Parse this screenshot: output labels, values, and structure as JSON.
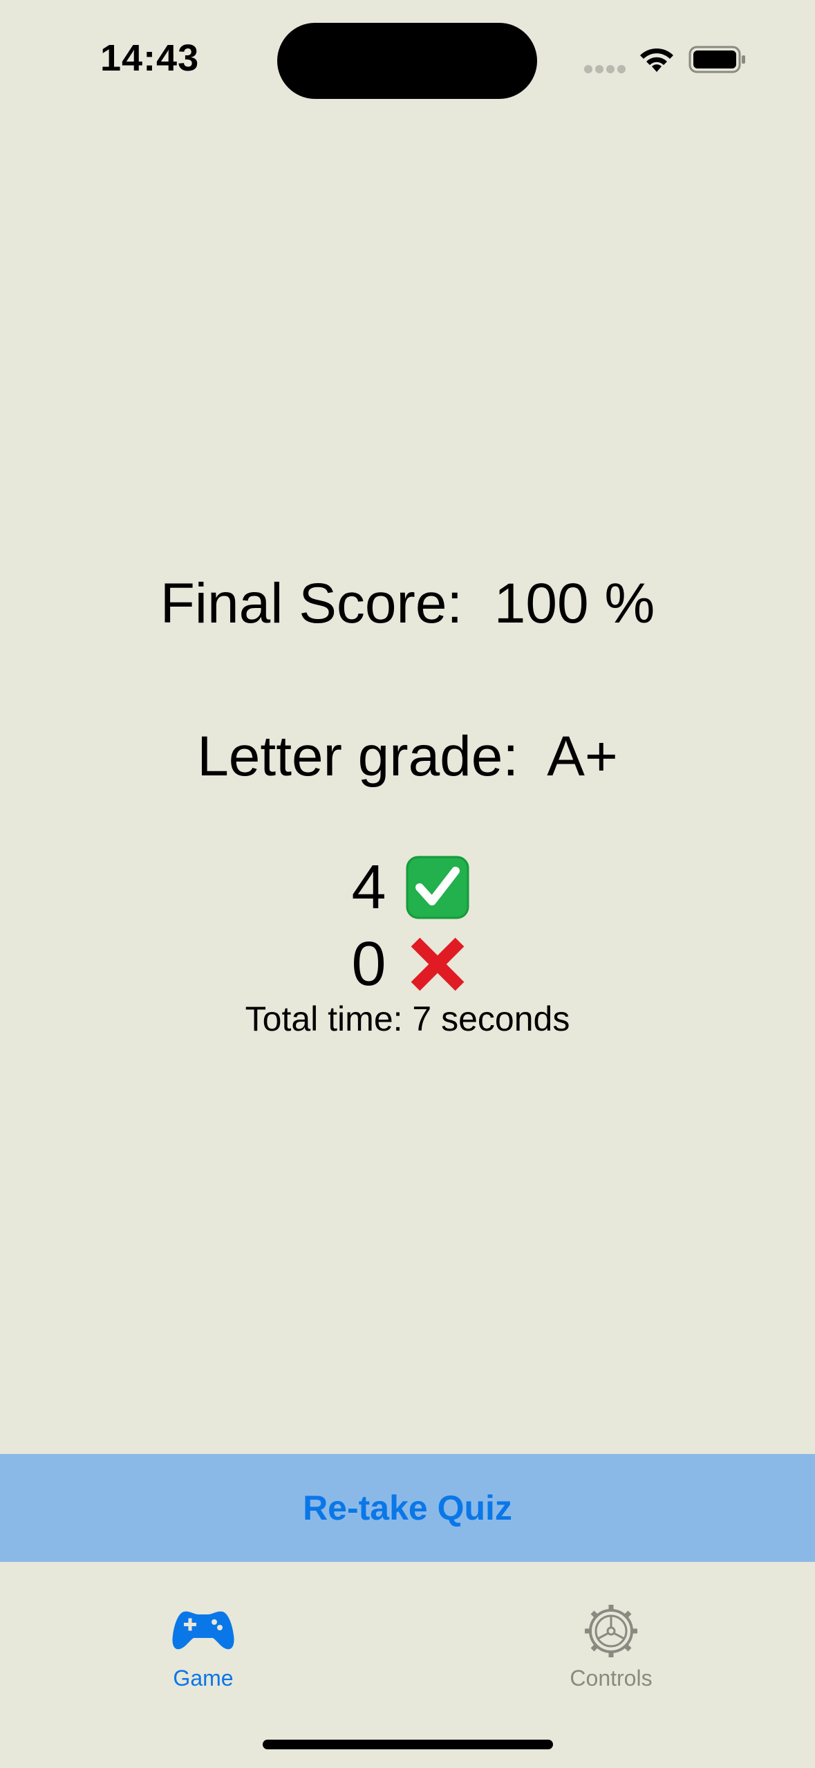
{
  "status_bar": {
    "time": "14:43"
  },
  "results": {
    "final_score_text": "Final Score:  100 %",
    "letter_grade_text": "Letter grade:  A+",
    "correct_count": "4",
    "wrong_count": "0",
    "total_time_text": "Total time: 7 seconds"
  },
  "icons": {
    "correct": "check-mark-button-icon",
    "wrong": "cross-mark-icon",
    "game_tab": "game-controller-icon",
    "controls_tab": "gear-icon"
  },
  "actions": {
    "retake_label": "Re-take Quiz"
  },
  "tab_bar": {
    "tabs": [
      {
        "label": "Game",
        "selected": true
      },
      {
        "label": "Controls",
        "selected": false
      }
    ]
  },
  "colors": {
    "background": "#e7e7da",
    "accent": "#0a77e8",
    "retake_bar": "#8bb9e7",
    "inactive_tab": "#8a8a80",
    "check_green": "#22b14c",
    "cross_red": "#e01b24"
  }
}
